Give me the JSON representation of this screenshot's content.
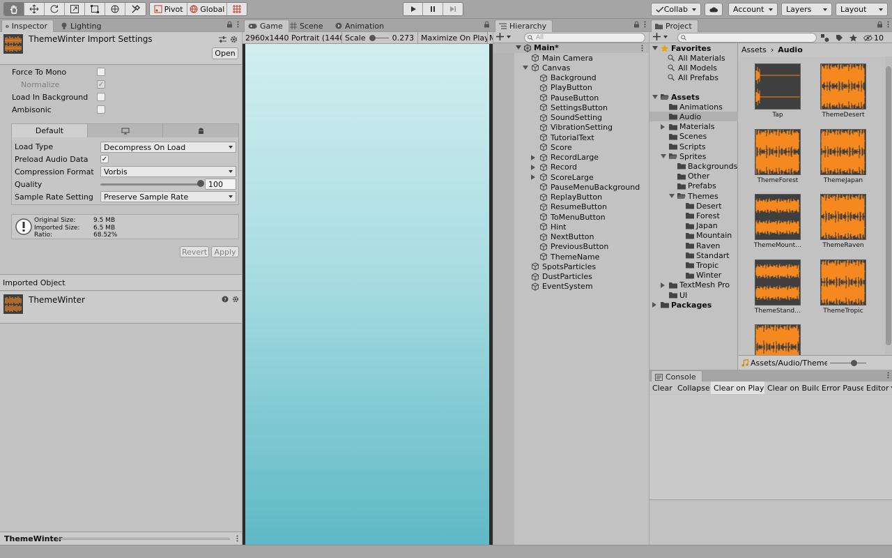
{
  "toolbar": {
    "pivot": "Pivot",
    "global": "Global",
    "collab": "Collab",
    "account": "Account",
    "layers": "Layers",
    "layout": "Layout"
  },
  "inspector": {
    "tabs": [
      "Inspector",
      "Lighting"
    ],
    "title": "ThemeWinter Import Settings",
    "open": "Open",
    "force_to_mono": "Force To Mono",
    "normalize": "Normalize",
    "load_in_background": "Load In Background",
    "ambisonic": "Ambisonic",
    "platform_default": "Default",
    "load_type_label": "Load Type",
    "load_type": "Decompress On Load",
    "preload_label": "Preload Audio Data",
    "compression_label": "Compression Format",
    "compression": "Vorbis",
    "quality_label": "Quality",
    "quality": "100",
    "quality_level": 1.0,
    "sample_rate_label": "Sample Rate Setting",
    "sample_rate": "Preserve Sample Rate",
    "info": [
      [
        "Original Size:",
        "9.5 MB"
      ],
      [
        "Imported Size:",
        "6.5 MB"
      ],
      [
        "Ratio:",
        "68.52%"
      ]
    ],
    "revert": "Revert",
    "apply": "Apply",
    "imported_object_header": "Imported Object",
    "imported_name": "ThemeWinter",
    "footer": "ThemeWinter"
  },
  "game": {
    "tabs": [
      "Game",
      "Scene",
      "Animation"
    ],
    "resolution": "2960x1440 Portrait (1440",
    "scale_label": "Scale",
    "scale_value": "0.273",
    "maximize": "Maximize On Play",
    "more": "M"
  },
  "hierarchy": {
    "tab": "Hierarchy",
    "search_placeholder": "All",
    "scene": "Main*",
    "items": [
      {
        "name": "Main Camera",
        "depth": 1,
        "arrow": ""
      },
      {
        "name": "Canvas",
        "depth": 1,
        "arrow": "open"
      },
      {
        "name": "Background",
        "depth": 2,
        "arrow": ""
      },
      {
        "name": "PlayButton",
        "depth": 2,
        "arrow": ""
      },
      {
        "name": "PauseButton",
        "depth": 2,
        "arrow": ""
      },
      {
        "name": "SettingsButton",
        "depth": 2,
        "arrow": ""
      },
      {
        "name": "SoundSetting",
        "depth": 2,
        "arrow": ""
      },
      {
        "name": "VibrationSetting",
        "depth": 2,
        "arrow": ""
      },
      {
        "name": "TutorialText",
        "depth": 2,
        "arrow": ""
      },
      {
        "name": "Score",
        "depth": 2,
        "arrow": ""
      },
      {
        "name": "RecordLarge",
        "depth": 2,
        "arrow": "closed"
      },
      {
        "name": "Record",
        "depth": 2,
        "arrow": "closed"
      },
      {
        "name": "ScoreLarge",
        "depth": 2,
        "arrow": "closed"
      },
      {
        "name": "PauseMenuBackground",
        "depth": 2,
        "arrow": ""
      },
      {
        "name": "ReplayButton",
        "depth": 2,
        "arrow": ""
      },
      {
        "name": "ResumeButton",
        "depth": 2,
        "arrow": ""
      },
      {
        "name": "ToMenuButton",
        "depth": 2,
        "arrow": ""
      },
      {
        "name": "Hint",
        "depth": 2,
        "arrow": ""
      },
      {
        "name": "NextButton",
        "depth": 2,
        "arrow": ""
      },
      {
        "name": "PreviousButton",
        "depth": 2,
        "arrow": ""
      },
      {
        "name": "ThemeName",
        "depth": 2,
        "arrow": ""
      },
      {
        "name": "SpotsParticles",
        "depth": 1,
        "arrow": ""
      },
      {
        "name": "DustParticles",
        "depth": 1,
        "arrow": ""
      },
      {
        "name": "EventSystem",
        "depth": 1,
        "arrow": ""
      }
    ]
  },
  "project": {
    "tab": "Project",
    "badge": "10",
    "breadcrumb": [
      "Assets",
      "Audio"
    ],
    "favorites": "Favorites",
    "fav_items": [
      "All Materials",
      "All Models",
      "All Prefabs"
    ],
    "tree": [
      {
        "name": "Assets",
        "depth": 0,
        "arrow": "open",
        "bold": true
      },
      {
        "name": "Animations",
        "depth": 1,
        "arrow": ""
      },
      {
        "name": "Audio",
        "depth": 1,
        "arrow": "",
        "selected": true
      },
      {
        "name": "Materials",
        "depth": 1,
        "arrow": "closed"
      },
      {
        "name": "Scenes",
        "depth": 1,
        "arrow": ""
      },
      {
        "name": "Scripts",
        "depth": 1,
        "arrow": ""
      },
      {
        "name": "Sprites",
        "depth": 1,
        "arrow": "open"
      },
      {
        "name": "Backgrounds",
        "depth": 2,
        "arrow": ""
      },
      {
        "name": "Other",
        "depth": 2,
        "arrow": ""
      },
      {
        "name": "Prefabs",
        "depth": 2,
        "arrow": ""
      },
      {
        "name": "Themes",
        "depth": 2,
        "arrow": "open"
      },
      {
        "name": "Desert",
        "depth": 3,
        "arrow": ""
      },
      {
        "name": "Forest",
        "depth": 3,
        "arrow": ""
      },
      {
        "name": "Japan",
        "depth": 3,
        "arrow": ""
      },
      {
        "name": "Mountain",
        "depth": 3,
        "arrow": ""
      },
      {
        "name": "Raven",
        "depth": 3,
        "arrow": ""
      },
      {
        "name": "Standart",
        "depth": 3,
        "arrow": ""
      },
      {
        "name": "Tropic",
        "depth": 3,
        "arrow": ""
      },
      {
        "name": "Winter",
        "depth": 3,
        "arrow": ""
      },
      {
        "name": "TextMesh Pro",
        "depth": 1,
        "arrow": "closed"
      },
      {
        "name": "UI",
        "depth": 1,
        "arrow": ""
      },
      {
        "name": "Packages",
        "depth": 0,
        "arrow": "closed",
        "bold": true
      }
    ],
    "assets": [
      "Tap",
      "ThemeDesert",
      "ThemeForest",
      "ThemeJapan",
      "ThemeMount…",
      "ThemeRaven",
      "ThemeStand…",
      "ThemeTropic",
      ""
    ],
    "status_path": "Assets/Audio/ThemeWinter."
  },
  "console": {
    "tab": "Console",
    "buttons": [
      "Clear",
      "Collapse",
      "Clear on Play",
      "Clear on Build",
      "Error Pause",
      "Editor"
    ]
  },
  "colors": {
    "accent_waveform": "#f5881f",
    "thumb_bg": "#3f3f3f",
    "selected_row": "#b0b0b0",
    "game_top": "#d1eef0",
    "game_bottom": "#5fb9c6"
  }
}
